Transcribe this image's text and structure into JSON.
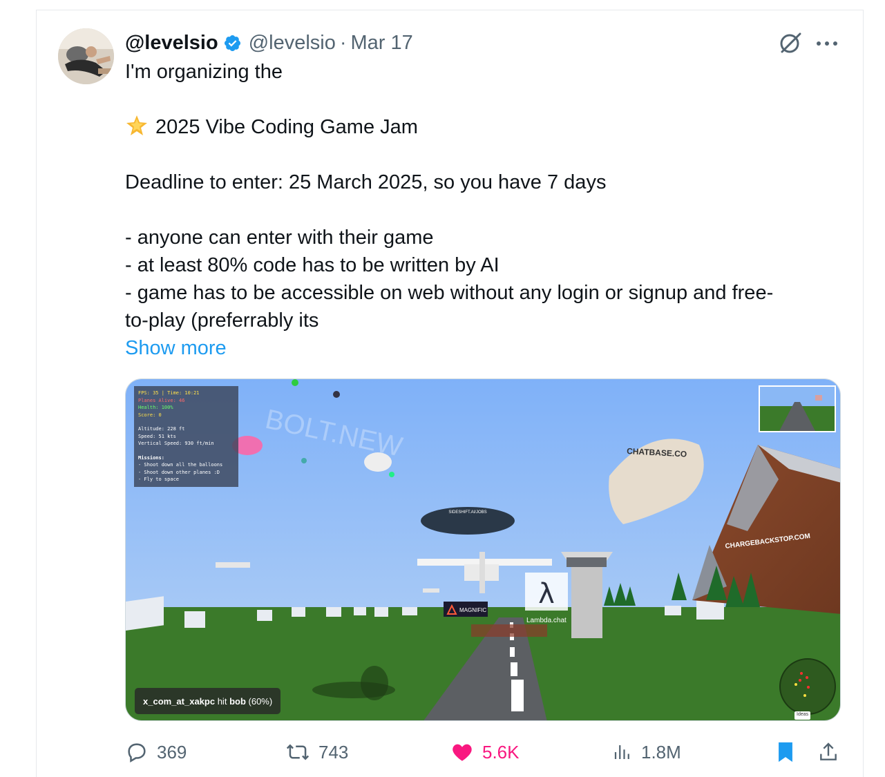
{
  "author": {
    "display_name": "@levelsio",
    "handle": "@levelsio",
    "separator": "·",
    "date": "Mar 17"
  },
  "tweet": {
    "line1": "I'm organizing the",
    "line2": "2025 Vibe Coding Game Jam",
    "line3": "Deadline to enter: 25 March 2025, so you have 7 days",
    "bullets": [
      "- anyone can enter with their game",
      "- at least 80% code has to be written by AI",
      "- game has to be accessible on web without any login or signup and free-",
      "to-play (preferrably its"
    ],
    "show_more": "Show more"
  },
  "media": {
    "hud": {
      "fps": "FPS: 35 | Time: 10:21",
      "planes": "Planes Alive: 46",
      "health": "Health: 100%",
      "score": "Score: 0",
      "altitude": "Altitude: 228 ft",
      "speed": "Speed: 51 kts",
      "vertical_speed": "Vertical Speed: 930 ft/min",
      "missions_title": "Missions:",
      "missions": [
        "- Shoot down all the balloons",
        "- Shoot down other planes :D",
        "- Fly to space"
      ]
    },
    "toast_user": "x_com_at_xakpc",
    "toast_hit": "hit",
    "toast_target": "bob",
    "toast_pct": "(60%)",
    "billboards": {
      "chatbase": "CHATBASE.CO",
      "chargeback": "CHARGEBACKSTOP.COM",
      "sideshift": "SIDESHIFT.AI/JOBS",
      "magnific": "MAGNIFIC",
      "lambda": "Lambda.chat",
      "bolt": "BOLT.NEW"
    },
    "ideas": "Ideas"
  },
  "actions": {
    "replies": "369",
    "reposts": "743",
    "likes": "5.6K",
    "views": "1.8M"
  },
  "colors": {
    "link": "#1d9bf0",
    "like": "#f91880",
    "muted": "#536471",
    "verified": "#1d9bf0"
  }
}
